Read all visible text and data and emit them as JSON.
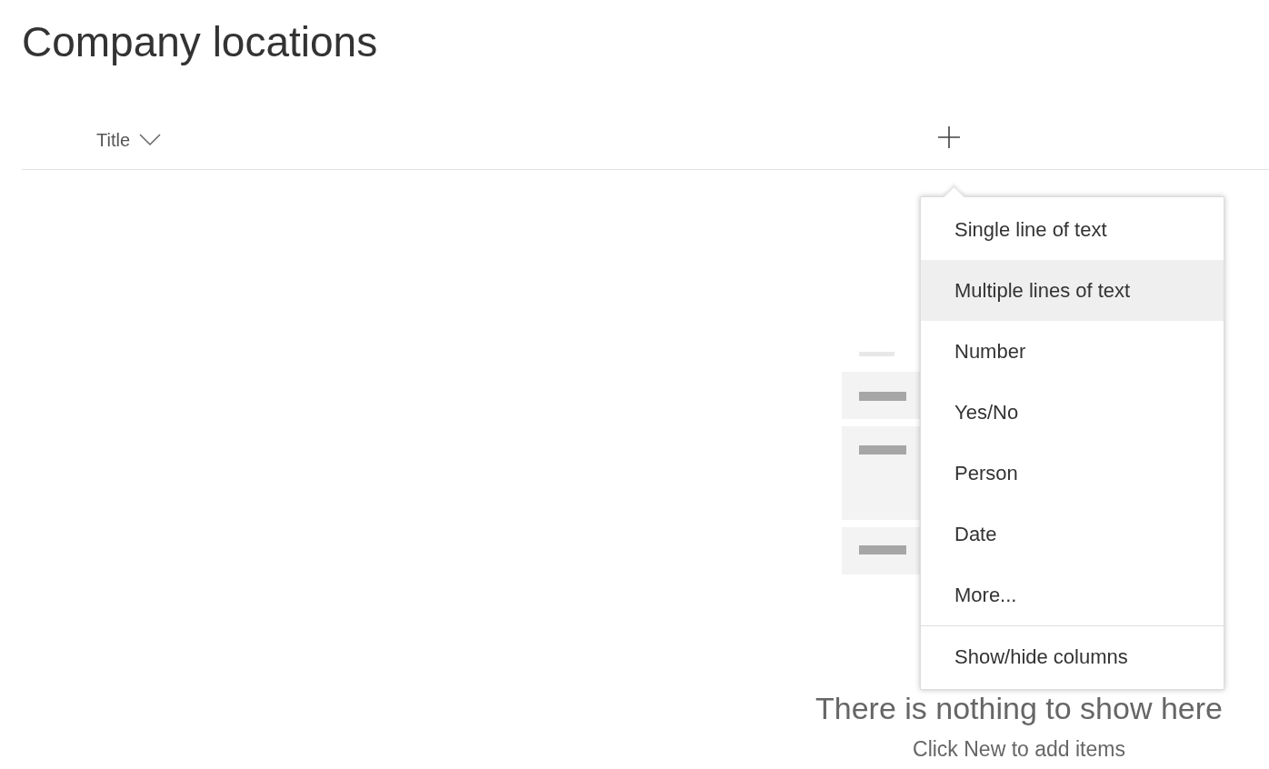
{
  "page_title": "Company locations",
  "columns": [
    {
      "label": "Title"
    }
  ],
  "column_menu": {
    "items": [
      {
        "label": "Single line of text",
        "kind": "option",
        "selected": false
      },
      {
        "label": "Multiple lines of text",
        "kind": "option",
        "selected": true
      },
      {
        "label": "Number",
        "kind": "option",
        "selected": false
      },
      {
        "label": "Yes/No",
        "kind": "option",
        "selected": false
      },
      {
        "label": "Person",
        "kind": "option",
        "selected": false
      },
      {
        "label": "Date",
        "kind": "option",
        "selected": false
      },
      {
        "label": "More...",
        "kind": "option",
        "selected": false
      },
      {
        "label": "Show/hide columns",
        "kind": "action",
        "selected": false
      }
    ]
  },
  "empty_state": {
    "title": "There is nothing to show here",
    "subtitle": "Click New to add items"
  }
}
